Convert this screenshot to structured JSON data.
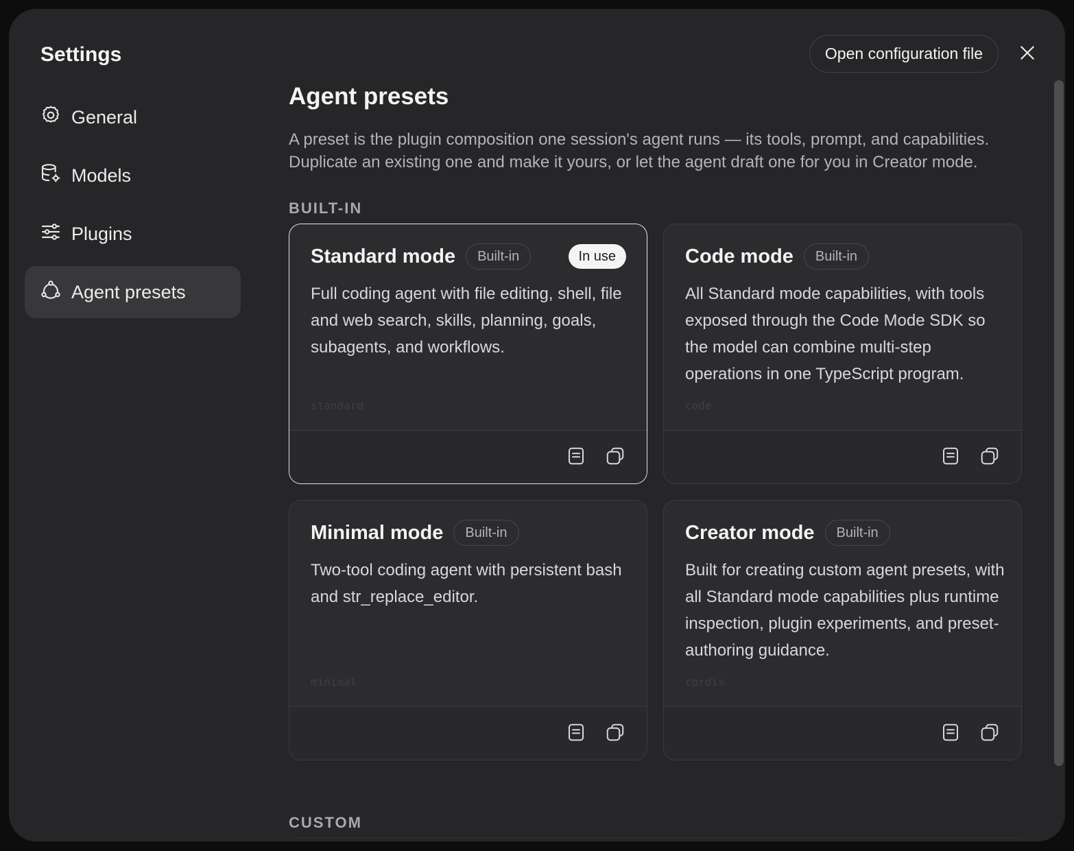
{
  "settings_title": "Settings",
  "header": {
    "open_config_label": "Open configuration file"
  },
  "sidebar": {
    "items": [
      {
        "label": "General",
        "icon": "gear-icon"
      },
      {
        "label": "Models",
        "icon": "database-gear-icon"
      },
      {
        "label": "Plugins",
        "icon": "sliders-icon"
      },
      {
        "label": "Agent presets",
        "icon": "nodes-icon",
        "active": true
      }
    ]
  },
  "main": {
    "title": "Agent presets",
    "description": "A preset is the plugin composition one session's agent runs — its tools, prompt, and capabilities. Duplicate an existing one and make it yours, or let the agent draft one for you in Creator mode.",
    "builtin_label": "BUILT-IN",
    "custom_label": "CUSTOM",
    "presets": [
      {
        "title": "Standard mode",
        "badge": "Built-in",
        "status": "In use",
        "description": "Full coding agent with file editing, shell, file and web search, skills, planning, goals, subagents, and workflows.",
        "id": "standard"
      },
      {
        "title": "Code mode",
        "badge": "Built-in",
        "description": "All Standard mode capabilities, with tools exposed through the Code Mode SDK so the model can combine multi-step operations in one TypeScript program.",
        "id": "code"
      },
      {
        "title": "Minimal mode",
        "badge": "Built-in",
        "description": "Two-tool coding agent with persistent bash and str_replace_editor.",
        "id": "minimal"
      },
      {
        "title": "Creator mode",
        "badge": "Built-in",
        "description": "Built for creating custom agent presets, with all Standard mode capabilities plus runtime inspection, plugin experiments, and preset-authoring guidance.",
        "id": "cordis"
      }
    ]
  },
  "colors": {
    "background": "#0d0d0e",
    "modal": "#262628",
    "card": "#2c2c2f",
    "active_border": "#e6e6e6"
  }
}
